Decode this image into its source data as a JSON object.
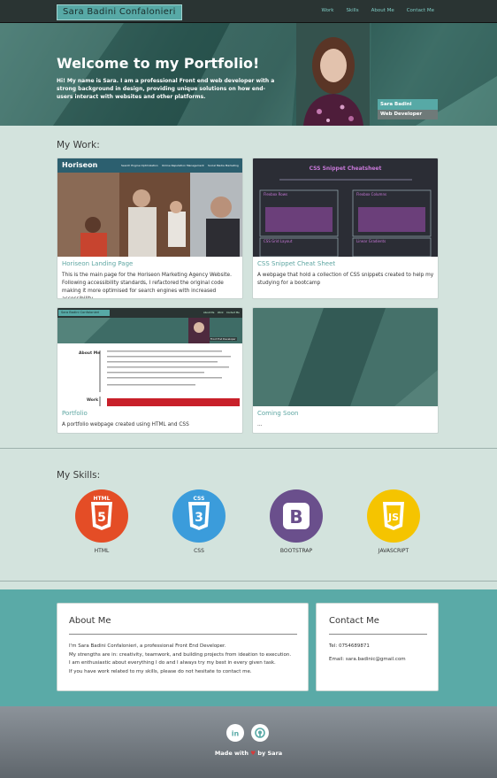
{
  "nav": {
    "brand": "Sara Badini Confalonieri",
    "links": [
      "Work",
      "Skills",
      "About Me",
      "Contact Me"
    ]
  },
  "hero": {
    "title": "Welcome to my Portfolio!",
    "text": "Hi! My name is Sara. I am a professional Front end web developer with a strong background in design, providing unique solutions on how end-users interact with websites and other platforms.",
    "name_tag": "Sara Badini Confalonieri",
    "role_tag": "Web Developer"
  },
  "work": {
    "heading": "My Work:",
    "cards": [
      {
        "title": "Horiseon Landing Page",
        "desc": "This is the main page for the Horiseon Marketing Agency Website. Following accessibility standards, I refactored the original code making it more optimised for search engines with increased accessibility.",
        "thumb": {
          "logo": "Horiseon",
          "links": [
            "Search Engine Optimization",
            "Online Reputation Management",
            "Social Media Marketing"
          ]
        }
      },
      {
        "title": "CSS Snippet Cheat Sheet",
        "desc": "A webpage that hold a collection of CSS snippets created to help my studying for a bootcamp",
        "thumb": {
          "heading": "CSS Snippet Cheatsheet",
          "panels": [
            "Flexbox Rows",
            "Flexbox Columns",
            "CSS Grid Layout",
            "Linear Gradients"
          ]
        }
      },
      {
        "title": "Portfolio",
        "desc": "A portfolio webpage created using HTML and CSS",
        "thumb": {
          "brand": "Sara Badini Confalonieri",
          "links": [
            "About Me",
            "Work",
            "Contact Me"
          ],
          "side1": "About Me",
          "side2": "Work",
          "tag": "Front End Developer"
        }
      },
      {
        "title": "Coming Soon",
        "desc": "..."
      }
    ]
  },
  "skills": {
    "heading": "My Skills:",
    "items": [
      {
        "label": "HTML",
        "icon": "html5-icon",
        "color": "#e44d26",
        "glyph": "5",
        "top": "HTML"
      },
      {
        "label": "CSS",
        "icon": "css3-icon",
        "color": "#3b9cdb",
        "glyph": "3",
        "top": "CSS"
      },
      {
        "label": "BOOTSTRAP",
        "icon": "bootstrap-icon",
        "color": "#6a4f8c",
        "glyph": "B",
        "top": ""
      },
      {
        "label": "JAVASCRIPT",
        "icon": "javascript-icon",
        "color": "#f5c400",
        "glyph": "JS",
        "top": ""
      }
    ]
  },
  "about": {
    "heading": "About Me",
    "lines": [
      "I'm Sara Badini Confalonieri, a professional Front End Developer.",
      "My strengths are in: creativity, teamwork, and building projects from ideation to execution.",
      "I am enthusiastic about everything I do and I always try my best in every given task.",
      "If you have work related to my skills, please do not hesitate to contact me."
    ]
  },
  "contact": {
    "heading": "Contact Me",
    "tel": "Tel: 0754689871",
    "email": "Email: sara.badinic@gmail.com"
  },
  "footer": {
    "made_prefix": "Made with",
    "made_suffix": "by Sara",
    "heart": "♥",
    "icons": [
      "linkedin-icon",
      "github-icon"
    ]
  },
  "colors": {
    "accent": "#57a9a6",
    "nav_bg": "#2a3433",
    "page_bg": "#d3e3dd",
    "teal_band": "#5aaaa7"
  }
}
